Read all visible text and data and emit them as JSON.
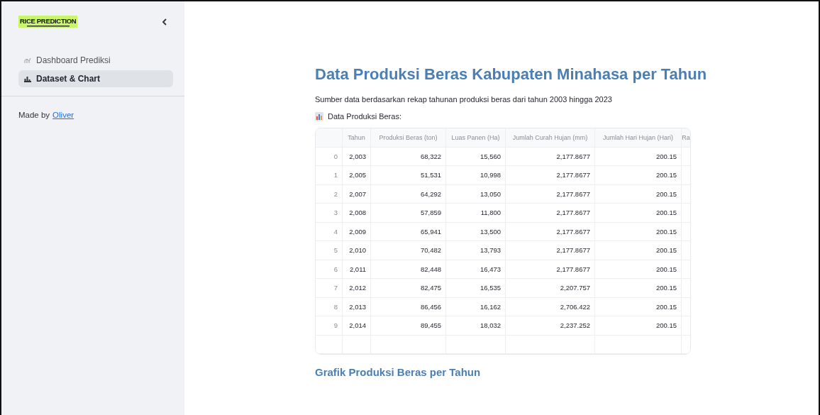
{
  "sidebar": {
    "logo": "RICE PREDICTION",
    "nav": [
      {
        "label": "Dashboard Prediksi",
        "kind": "chart",
        "selected": false
      },
      {
        "label": "Dataset & Chart",
        "kind": "bars",
        "selected": true
      }
    ],
    "footer_prefix": "Made by",
    "footer_link": "Oliver"
  },
  "main": {
    "title": "Data Produksi Beras Kabupaten Minahasa per Tahun",
    "description": "Sumber data berdasarkan rekap tahunan produksi beras dari tahun 2003 hingga 2023",
    "table_label": "Data Produksi Beras:",
    "table": {
      "columns": [
        "",
        "Tahun",
        "Produksi Beras (ton)",
        "Luas Panen (Ha)",
        "Jumlah Curah Hujan (mm)",
        "Jumlah Hari Hujan (Hari)",
        "Ra"
      ],
      "rows": [
        [
          "0",
          "2,003",
          "68,322",
          "15,560",
          "2,177.8677",
          "200.15"
        ],
        [
          "1",
          "2,005",
          "51,531",
          "10,998",
          "2,177.8677",
          "200.15"
        ],
        [
          "2",
          "2,007",
          "64,292",
          "13,050",
          "2,177.8677",
          "200.15"
        ],
        [
          "3",
          "2,008",
          "57,859",
          "11,800",
          "2,177.8677",
          "200.15"
        ],
        [
          "4",
          "2,009",
          "65,941",
          "13,500",
          "2,177.8677",
          "200.15"
        ],
        [
          "5",
          "2,010",
          "70,482",
          "13,793",
          "2,177.8677",
          "200.15"
        ],
        [
          "6",
          "2,011",
          "82,448",
          "16,473",
          "2,177.8677",
          "200.15"
        ],
        [
          "7",
          "2,012",
          "82,475",
          "16,535",
          "2,207.757",
          "200.15"
        ],
        [
          "8",
          "2,013",
          "86,456",
          "16,162",
          "2,706.422",
          "200.15"
        ],
        [
          "9",
          "2,014",
          "89,455",
          "18,032",
          "2,237.252",
          "200.15"
        ]
      ]
    },
    "chart_heading": "Grafik Produksi Beras per Tahun"
  }
}
